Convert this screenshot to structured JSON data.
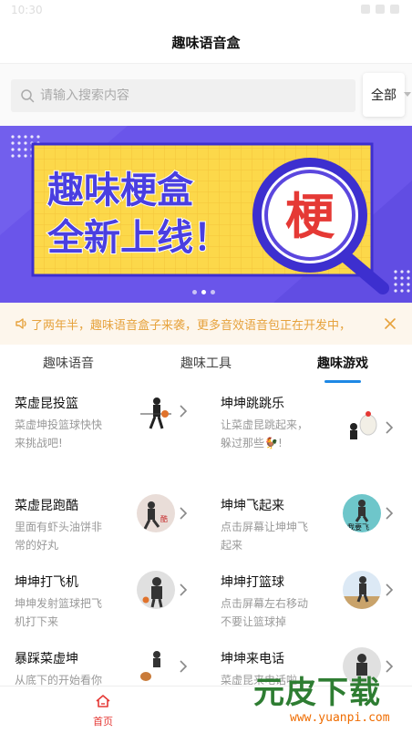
{
  "status_bar": {
    "time": "10:30"
  },
  "header": {
    "title": "趣味语音盒"
  },
  "search": {
    "placeholder": "请输入搜索内容",
    "scope_label": "全部"
  },
  "banner": {
    "line1": "趣味梗盒",
    "line2": "全新上线！",
    "badge": "梗",
    "page_count": 3,
    "active_page": 2,
    "colors": {
      "background": "#6a55ea",
      "card": "#fcd84a",
      "text": "#4a3fe0",
      "badge": "#e53935"
    }
  },
  "notice": {
    "text": "了两年半，趣味语音盒子来袭，更多音效语音包正在开发中，"
  },
  "tabs": [
    {
      "label": "趣味语音",
      "active": false
    },
    {
      "label": "趣味工具",
      "active": false
    },
    {
      "label": "趣味游戏",
      "active": true
    }
  ],
  "games": [
    {
      "title": "菜虚昆投篮",
      "desc": "菜虚坤投篮球快快来挑战吧!",
      "thumb": "basketball-shot-thumb"
    },
    {
      "title": "坤坤跳跳乐",
      "desc": "让菜虚昆跳起来，躲过那些🐓!",
      "thumb": "chicken-jump-thumb"
    },
    {
      "title": "菜虚昆跑酷",
      "desc": "里面有虾头油饼非常的好丸",
      "thumb": "parkour-thumb",
      "thumb_text": "酷"
    },
    {
      "title": "坤坤飞起来",
      "desc": "点击屏幕让坤坤飞起来",
      "thumb": "fly-thumb",
      "thumb_text": "我要飞"
    },
    {
      "title": "坤坤打飞机",
      "desc": "坤坤发射篮球把飞机打下来",
      "thumb": "plane-shooter-thumb"
    },
    {
      "title": "坤坤打篮球",
      "desc": "点击屏幕左右移动不要让篮球掉",
      "thumb": "basketball-catch-thumb"
    },
    {
      "title": "暴踩菜虚坤",
      "desc": "从底下的开始看你能得多少分",
      "thumb": "stomp-thumb"
    },
    {
      "title": "坤坤来电话",
      "desc": "菜虚昆来电话啦",
      "thumb": "phone-call-thumb"
    }
  ],
  "bottom_nav": {
    "home_label": "首页",
    "accent": "#e53935"
  },
  "watermark": {
    "brand": "元皮下载",
    "url": "www.yuanpi.com"
  }
}
